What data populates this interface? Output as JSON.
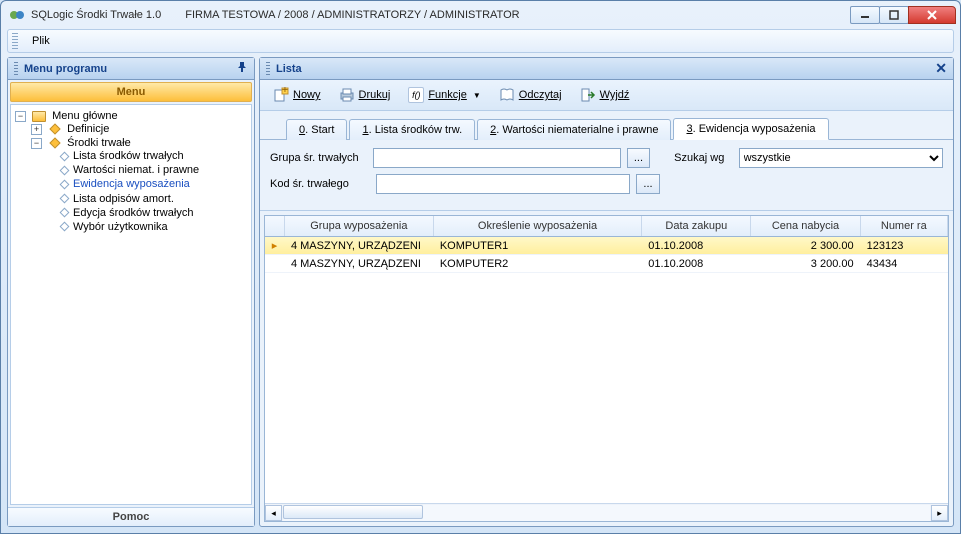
{
  "window": {
    "app_title": "SQLogic Środki Trwałe 1.0",
    "context": "FIRMA TESTOWA / 2008 / ADMINISTRATORZY / ADMINISTRATOR"
  },
  "menubar": {
    "file": "Plik"
  },
  "left_panel": {
    "title": "Menu programu",
    "section": "Menu",
    "help": "Pomoc",
    "tree": {
      "root": "Menu główne",
      "definicje": "Definicje",
      "srodki": "Środki trwałe",
      "leaves": [
        "Lista środków trwałych",
        "Wartości niemat. i prawne",
        "Ewidencja wyposażenia",
        "Lista odpisów amort.",
        "Edycja środków trwałych",
        "Wybór użytkownika"
      ]
    }
  },
  "right_panel": {
    "title": "Lista",
    "toolbar": {
      "nowy": "Nowy",
      "drukuj": "Drukuj",
      "funkcje": "Funkcje",
      "odczytaj": "Odczytaj",
      "wyjdz": "Wyjdź",
      "fn_badge": "f()"
    },
    "tabs": [
      {
        "key": "0",
        "label": ". Start"
      },
      {
        "key": "1",
        "label": ". Lista środków trw."
      },
      {
        "key": "2",
        "label": ". Wartości niematerialne i prawne"
      },
      {
        "key": "3",
        "label": ". Ewidencja wyposażenia"
      }
    ],
    "filters": {
      "grupa_label": "Grupa śr. trwałych",
      "kod_label": "Kod śr. trwałego",
      "grupa_value": "",
      "kod_value": "",
      "szukaj_label": "Szukaj wg",
      "szukaj_value": "wszystkie",
      "pick": "..."
    },
    "grid": {
      "headers": [
        "",
        "Grupa wyposażenia",
        "Określenie wyposażenia",
        "Data zakupu",
        "Cena nabycia",
        "Numer ra"
      ],
      "rows": [
        {
          "grp": "4 MASZYNY, URZĄDZENI",
          "def": "KOMPUTER1",
          "date": "01.10.2008",
          "price": "2 300.00",
          "num": "123123"
        },
        {
          "grp": "4 MASZYNY, URZĄDZENI",
          "def": "KOMPUTER2",
          "date": "01.10.2008",
          "price": "3 200.00",
          "num": "43434"
        }
      ]
    }
  }
}
